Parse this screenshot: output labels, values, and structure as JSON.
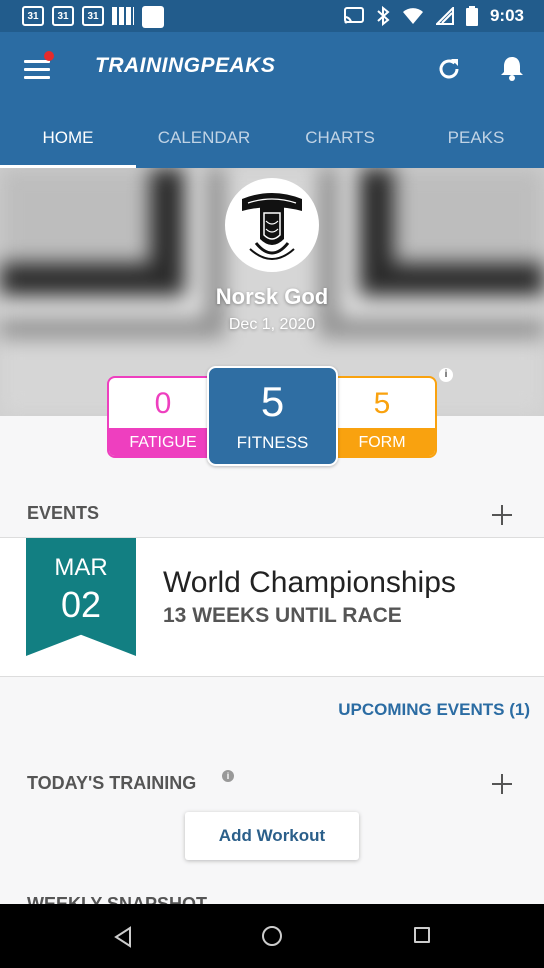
{
  "status_bar": {
    "calendar_icons": [
      "31",
      "31",
      "31"
    ],
    "time": "9:03",
    "icons": [
      "cast-icon",
      "bluetooth-icon",
      "wifi-icon",
      "signal-icon",
      "battery-icon"
    ]
  },
  "app_bar": {
    "brand": "TRAININGPEAKS",
    "has_notification_dot": true,
    "accent_color": "#2b6ca3"
  },
  "tabs": [
    {
      "label": "HOME",
      "active": true
    },
    {
      "label": "CALENDAR",
      "active": false
    },
    {
      "label": "CHARTS",
      "active": false
    },
    {
      "label": "PEAKS",
      "active": false
    }
  ],
  "profile": {
    "name": "Norsk God",
    "date": "Dec 1, 2020"
  },
  "metrics": {
    "fatigue": {
      "value": "0",
      "label": "FATIGUE",
      "color": "#ee3fbf"
    },
    "fitness": {
      "value": "5",
      "label": "FITNESS",
      "color": "#2f6ea3"
    },
    "form": {
      "value": "5",
      "label": "FORM",
      "color": "#f9a20f"
    }
  },
  "events": {
    "header": "EVENTS",
    "event": {
      "month": "MAR",
      "day": "02",
      "name": "World Championships",
      "countdown": "13 WEEKS UNTIL RACE",
      "color": "#127f82"
    },
    "upcoming_link": "UPCOMING EVENTS (1)"
  },
  "training": {
    "header": "TODAY'S TRAINING",
    "add_button": "Add Workout"
  },
  "weekly": {
    "header": "WEEKLY SNAPSHOT"
  }
}
